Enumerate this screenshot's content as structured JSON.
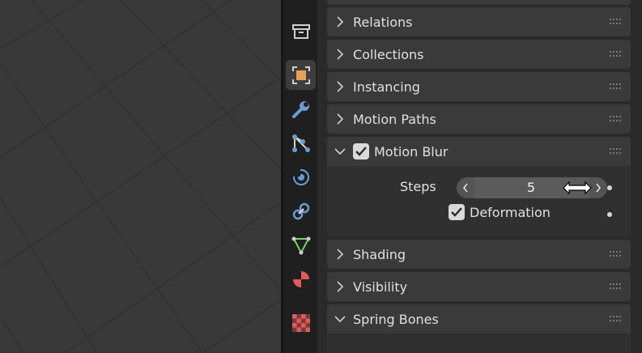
{
  "viewport": {
    "background": "#393939",
    "grid_color": "#2e2e2e"
  },
  "tabs": [
    {
      "name": "tool-tab",
      "icon": "archive-icon",
      "active": false
    },
    {
      "name": "object-tab",
      "icon": "object-icon",
      "active": true,
      "color": "#e5a05c"
    },
    {
      "name": "modifiers-tab",
      "icon": "wrench-icon",
      "active": false,
      "color": "#6d9bd6"
    },
    {
      "name": "particles-tab",
      "icon": "particles-icon",
      "active": false,
      "color": "#6d9bd6"
    },
    {
      "name": "physics-tab",
      "icon": "physics-icon",
      "active": false,
      "color": "#6d9bd6"
    },
    {
      "name": "constraints-tab",
      "icon": "constraint-icon",
      "active": false,
      "color": "#6d9bd6"
    },
    {
      "name": "data-tab",
      "icon": "mesh-data-icon",
      "active": false,
      "color": "#7ecf6c"
    },
    {
      "name": "material-tab",
      "icon": "material-icon",
      "active": false,
      "color": "#e05b5b"
    },
    {
      "name": "texture-tab",
      "icon": "texture-icon",
      "active": false,
      "color": "#e05b5b"
    }
  ],
  "panels": {
    "relations": "Relations",
    "collections": "Collections",
    "instancing": "Instancing",
    "motion_paths": "Motion Paths",
    "motion_blur": "Motion Blur",
    "shading": "Shading",
    "visibility": "Visibility",
    "spring_bones": "Spring Bones"
  },
  "motion_blur": {
    "enabled": true,
    "steps_label": "Steps",
    "steps_value": "5",
    "deformation_label": "Deformation",
    "deformation_checked": true
  }
}
